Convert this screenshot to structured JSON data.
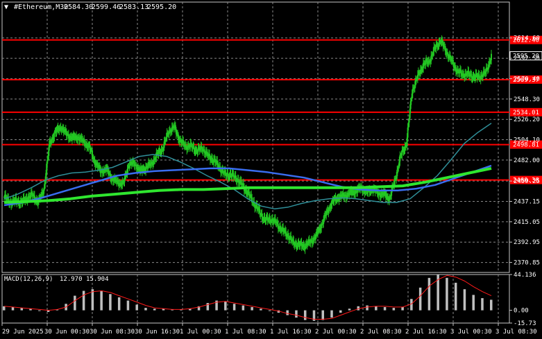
{
  "window": {
    "title": "#Ethereum,M30",
    "ohlc": [
      "2584.30",
      "2599.46",
      "2583.13",
      "2595.20"
    ]
  },
  "colors": {
    "background": "#000000",
    "grid": "#8a8a8a",
    "candle": "#23c823",
    "level": "#ff0000",
    "ma_fast": "#2f8f99",
    "ma_mid": "#3a6df0",
    "ma_slow": "#2fe62f",
    "macd_hist": "#c0c0c0",
    "macd_signal": "#ff1a1a",
    "text": "#ffffff"
  },
  "chart_data": [
    {
      "type": "candlestick",
      "title": "#Ethereum,M30",
      "ylim": [
        2360,
        2640
      ],
      "y_ticks": [
        "2370.85",
        "2392.95",
        "2415.05",
        "2437.15",
        "2459.25",
        "2482.00",
        "2504.10",
        "2526.20",
        "2548.30",
        "2570.40",
        "2592.50",
        "2614.60"
      ],
      "x_ticks": [
        "29 Jun 2025",
        "30 Jun 00:30",
        "30 Jun 08:30",
        "30 Jun 16:30",
        "1 Jul 00:30",
        "1 Jul 08:30",
        "1 Jul 16:30",
        "2 Jul 00:30",
        "2 Jul 08:30",
        "2 Jul 16:30",
        "3 Jul 00:30",
        "3 Jul 08:30"
      ],
      "levels": [
        "2612.40",
        "2569.37",
        "2534.01",
        "2498.81",
        "2460.38"
      ],
      "current_price": "2595.20",
      "price_path": [
        2442,
        2436,
        2438,
        2436,
        2441,
        2444,
        2436,
        2450,
        2500,
        2512,
        2518,
        2510,
        2506,
        2507,
        2502,
        2496,
        2480,
        2470,
        2472,
        2462,
        2458,
        2456,
        2478,
        2478,
        2470,
        2474,
        2478,
        2488,
        2495,
        2513,
        2518,
        2503,
        2497,
        2497,
        2492,
        2495,
        2486,
        2482,
        2474,
        2466,
        2466,
        2462,
        2455,
        2446,
        2436,
        2426,
        2417,
        2418,
        2414,
        2406,
        2401,
        2392,
        2390,
        2389,
        2393,
        2399,
        2412,
        2426,
        2437,
        2442,
        2443,
        2446,
        2448,
        2452,
        2447,
        2451,
        2446,
        2445,
        2440,
        2461,
        2487,
        2500,
        2557,
        2573,
        2586,
        2589,
        2603,
        2612,
        2600,
        2589,
        2578,
        2575,
        2575,
        2572,
        2573,
        2577,
        2595
      ],
      "ma_fast": [
        2440,
        2445,
        2452,
        2460,
        2465,
        2468,
        2469,
        2471,
        2474,
        2480,
        2486,
        2488,
        2486,
        2480,
        2473,
        2465,
        2458,
        2450,
        2440,
        2432,
        2429,
        2431,
        2435,
        2438,
        2440,
        2441,
        2440,
        2438,
        2436,
        2436,
        2440,
        2452,
        2465,
        2482,
        2500,
        2512,
        2522
      ],
      "ma_mid": [
        2433,
        2436,
        2441,
        2447,
        2453,
        2459,
        2465,
        2468,
        2470,
        2471,
        2472,
        2473,
        2473,
        2471,
        2469,
        2466,
        2463,
        2458,
        2453,
        2450,
        2449,
        2449,
        2451,
        2455,
        2462,
        2469,
        2476
      ],
      "ma_slow": [
        2436,
        2437,
        2438,
        2440,
        2443,
        2445,
        2447,
        2449,
        2450,
        2450,
        2451,
        2452,
        2452,
        2452,
        2452,
        2452,
        2452,
        2453,
        2454,
        2458,
        2463,
        2468,
        2473
      ]
    },
    {
      "type": "macd",
      "title": "MACD(12,26,9)",
      "values": [
        "12.970",
        "15.904"
      ],
      "ylim": [
        -15.73,
        44.136
      ],
      "y_ticks": [
        "44.136",
        "0.00",
        "-15.73"
      ],
      "histogram": [
        5,
        4,
        3,
        2,
        0,
        -2,
        1,
        8,
        18,
        24,
        26,
        24,
        20,
        16,
        12,
        7,
        3,
        2,
        2,
        1,
        1,
        2,
        5,
        9,
        12,
        11,
        8,
        6,
        4,
        2,
        0,
        -3,
        -6,
        -9,
        -12,
        -13,
        -12,
        -9,
        -3,
        2,
        5,
        6,
        5,
        4,
        3,
        4,
        14,
        28,
        40,
        44,
        40,
        34,
        26,
        19,
        15,
        13
      ],
      "signal": [
        5,
        4,
        3,
        2,
        1,
        0,
        1,
        4,
        12,
        19,
        23,
        24,
        22,
        18,
        14,
        10,
        6,
        3,
        2,
        1,
        1,
        2,
        4,
        7,
        10,
        11,
        9,
        7,
        5,
        3,
        1,
        -1,
        -4,
        -6,
        -9,
        -11,
        -11,
        -10,
        -6,
        -2,
        2,
        4,
        5,
        5,
        4,
        4,
        8,
        18,
        30,
        38,
        43,
        41,
        36,
        29,
        23,
        18
      ]
    }
  ]
}
